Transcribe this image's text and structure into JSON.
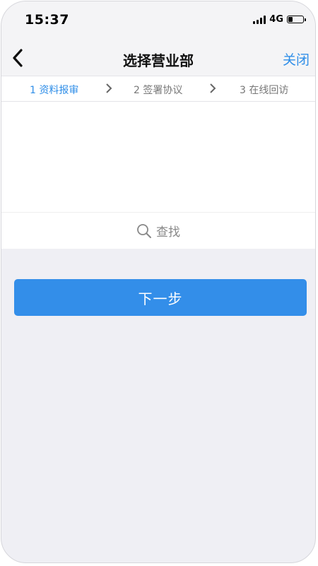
{
  "status_bar": {
    "time": "15:37",
    "network": "4G",
    "icons": [
      "signal-icon",
      "battery-icon"
    ],
    "battery_level": 0.3
  },
  "nav": {
    "title": "选择营业部",
    "back_icon": "chevron-left-icon",
    "close_label": "关闭"
  },
  "steps": [
    {
      "label": "1 资料报审",
      "active": true
    },
    {
      "label": "2 签署协议",
      "active": false
    },
    {
      "label": "3 在线回访",
      "active": false
    }
  ],
  "search": {
    "icon": "search-icon",
    "label": "查找"
  },
  "actions": {
    "next_label": "下一步"
  },
  "colors": {
    "accent": "#338ee9",
    "link": "#2f8ee8",
    "background": "#efeff4"
  }
}
